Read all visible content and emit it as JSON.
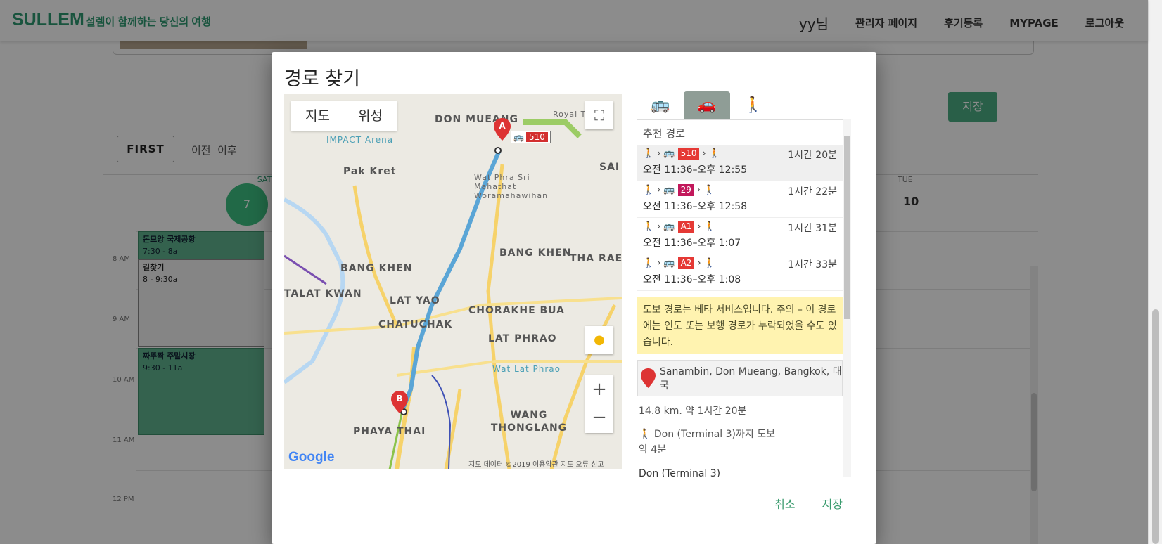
{
  "header": {
    "brand": "SULLEM",
    "tagline": "설렘이 함께하는 당신의 여행",
    "user": "yy님",
    "nav": [
      "관리자 페이지",
      "후기등록",
      "MYPAGE",
      "로그아웃"
    ]
  },
  "background": {
    "save_label": "저장",
    "first_label": "FIRST",
    "prev_label": "이전",
    "next_label": "이후",
    "day_sat": "SAT",
    "date_sat": "7",
    "day_tue": "TUE",
    "date_tue": "10",
    "times": [
      "8 AM",
      "9 AM",
      "10 AM",
      "11 AM",
      "12 PM"
    ],
    "events": [
      {
        "title": "돈므앙 국제공항",
        "time": "7:30 - 8a"
      },
      {
        "title": "길찾기",
        "time": "8 - 9:30a"
      },
      {
        "title": "짜뚜짝 주말시장",
        "time": "9:30 - 11a"
      }
    ]
  },
  "modal": {
    "title": "경로 찾기",
    "map": {
      "type_map": "지도",
      "type_satellite": "위성",
      "zoom_in": "+",
      "zoom_out": "−",
      "bus_number": "510",
      "marker_a": "A",
      "marker_b": "B",
      "labels": [
        "DON MUEANG",
        "IMPACT Arena",
        "Pak Kret",
        "Wat Phra Sri Mahathat Woramahawihan",
        "BANG KHEN",
        "TALAT KWAN",
        "LAT YAO",
        "CHATUCHAK",
        "CHORAKHE BUA",
        "LAT PHRAO",
        "BANG KHEN",
        "THA RAE",
        "WANG THONGLANG",
        "PHAYA THAI",
        "Wat Lat Phrao",
        "Royal T",
        "SAI"
      ],
      "google": "Google",
      "footer": "지도 데이터 ©2019   이용약관   지도 오류 신고"
    },
    "panel": {
      "section_title": "추천 경로",
      "routes": [
        {
          "bus": "510",
          "duration": "1시간 20분",
          "times": "오전 11:36–오후 12:55"
        },
        {
          "bus": "29",
          "duration": "1시간 22분",
          "times": "오전 11:36–오후 12:58"
        },
        {
          "bus": "A1",
          "duration": "1시간 31분",
          "times": "오전 11:36–오후 1:07"
        },
        {
          "bus": "A2",
          "duration": "1시간 33분",
          "times": "오전 11:36–오후 1:08"
        }
      ],
      "warning": "도보 경로는 베타 서비스입니다. 주의 – 이 경로에는 인도 또는 보행 경로가 누락되었을 수도 있습니다.",
      "origin": "Sanambin, Don Mueang, Bangkok, 태국",
      "distance": "14.8 km. 약 1시간 20분",
      "step_walk": "Don (Terminal 3)까지 도보",
      "step_walk_time": "약 4분",
      "stop": "Don (Terminal 3)"
    },
    "cancel_label": "취소",
    "save_label": "저장"
  },
  "colors": {
    "brand": "#2e9a72",
    "bus_badge": "#e53935",
    "route_line": "#5aa5d6",
    "warning_bg": "#fff3b0"
  }
}
